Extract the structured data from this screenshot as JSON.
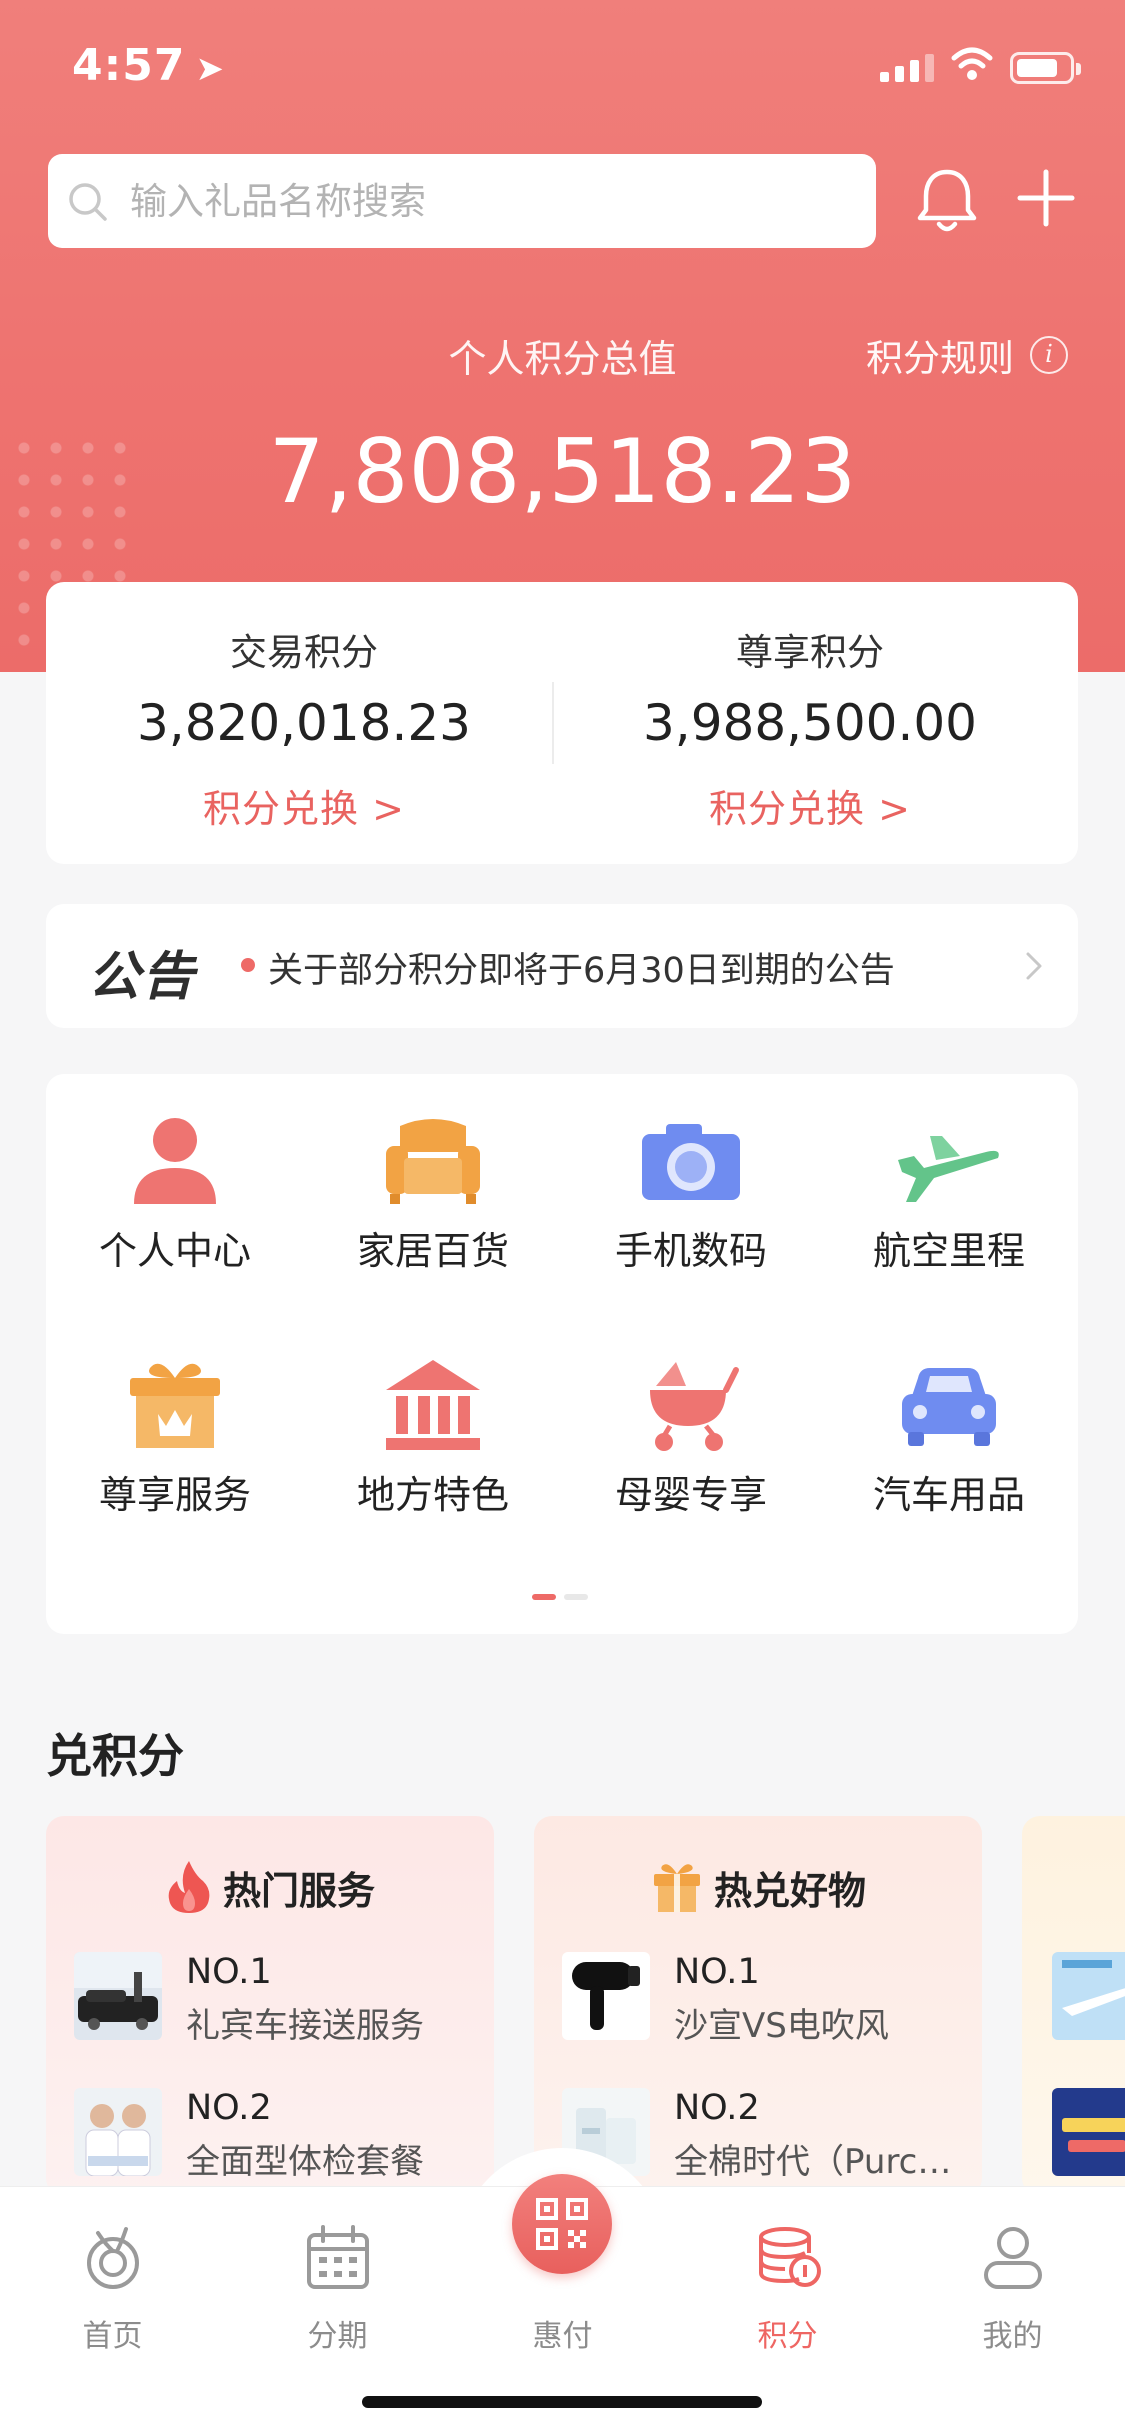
{
  "status_bar": {
    "time": "4:57"
  },
  "search": {
    "placeholder": "输入礼品名称搜索"
  },
  "summary": {
    "total_label": "个人积分总值",
    "rules_label": "积分规则",
    "total_value": "7,808,518.23"
  },
  "points": [
    {
      "label": "交易积分",
      "value": "3,820,018.23",
      "action": "积分兑换 >"
    },
    {
      "label": "尊享积分",
      "value": "3,988,500.00",
      "action": "积分兑换 >"
    }
  ],
  "notice": {
    "logo": "公告",
    "text": "关于部分积分即将于6月30日到期的公告"
  },
  "categories": [
    {
      "label": "个人中心",
      "icon": "person-icon",
      "color": "#ee7471"
    },
    {
      "label": "家居百货",
      "icon": "sofa-icon",
      "color": "#f2a344"
    },
    {
      "label": "手机数码",
      "icon": "camera-icon",
      "color": "#6f8cf0"
    },
    {
      "label": "航空里程",
      "icon": "airplane-icon",
      "color": "#63c48a"
    },
    {
      "label": "尊享服务",
      "icon": "gift-crown-icon",
      "color": "#f2a344"
    },
    {
      "label": "地方特色",
      "icon": "museum-icon",
      "color": "#ee7471"
    },
    {
      "label": "母婴专享",
      "icon": "stroller-icon",
      "color": "#ee7471"
    },
    {
      "label": "汽车用品",
      "icon": "car-icon",
      "color": "#6f8cf0"
    }
  ],
  "pager": {
    "pages": 2,
    "current": 1
  },
  "redeem": {
    "title": "兑积分",
    "cards": [
      {
        "title": "热门服务",
        "icon": "flame-icon",
        "items": [
          {
            "rank": "NO.1",
            "name": "礼宾车接送服务"
          },
          {
            "rank": "NO.2",
            "name": "全面型体检套餐"
          }
        ]
      },
      {
        "title": "热兑好物",
        "icon": "gift-icon",
        "items": [
          {
            "rank": "NO.1",
            "name": "沙宣VS电吹风"
          },
          {
            "rank": "NO.2",
            "name": "全棉时代（Purcotton）"
          }
        ]
      }
    ]
  },
  "tabbar": {
    "items": [
      {
        "label": "首页",
        "icon": "home-swirl-icon",
        "active": false
      },
      {
        "label": "分期",
        "icon": "calendar-icon",
        "active": false
      },
      {
        "label": "惠付",
        "icon": "qr-code-icon",
        "active": false
      },
      {
        "label": "积分",
        "icon": "coins-icon",
        "active": true
      },
      {
        "label": "我的",
        "icon": "user-icon",
        "active": false
      }
    ]
  },
  "colors": {
    "brand": "#ee6f6c",
    "accent_text": "#e96360"
  }
}
